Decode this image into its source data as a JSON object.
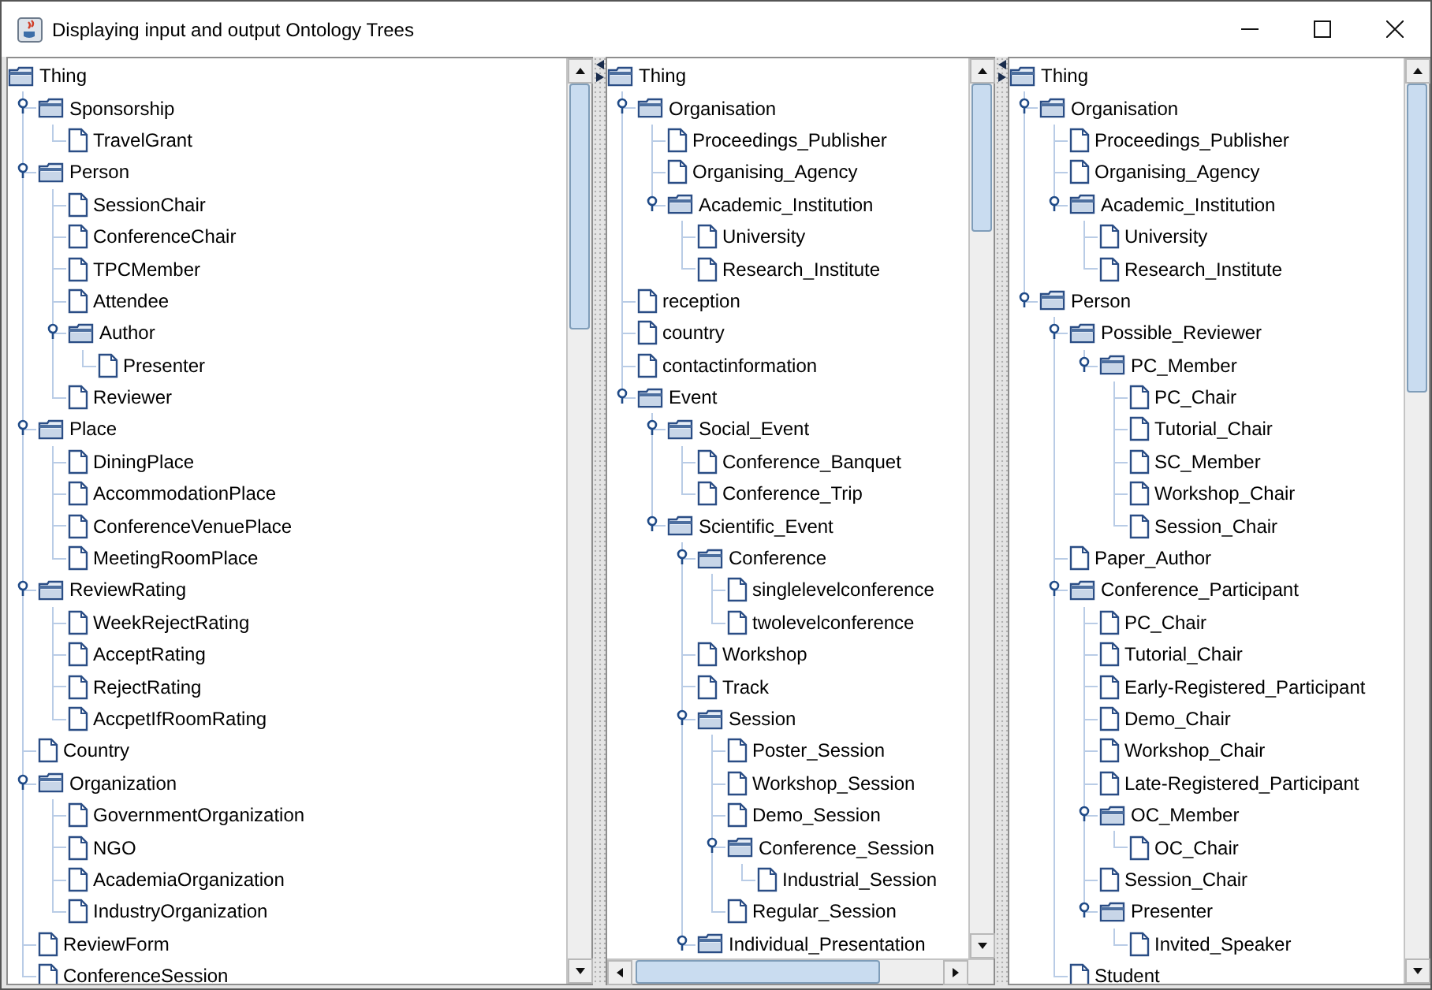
{
  "window": {
    "title": "Displaying input and output Ontology Trees"
  },
  "panes": [
    {
      "horizontal_scrollbar": false,
      "tree": {
        "label": "Thing",
        "kind": "folder",
        "expanded": true,
        "children": [
          {
            "label": "Sponsorship",
            "kind": "folder",
            "expanded": true,
            "children": [
              {
                "label": "TravelGrant",
                "kind": "leaf"
              }
            ]
          },
          {
            "label": "Person",
            "kind": "folder",
            "expanded": true,
            "children": [
              {
                "label": "SessionChair",
                "kind": "leaf"
              },
              {
                "label": "ConferenceChair",
                "kind": "leaf"
              },
              {
                "label": "TPCMember",
                "kind": "leaf"
              },
              {
                "label": "Attendee",
                "kind": "leaf"
              },
              {
                "label": "Author",
                "kind": "folder",
                "expanded": true,
                "children": [
                  {
                    "label": "Presenter",
                    "kind": "leaf"
                  }
                ]
              },
              {
                "label": "Reviewer",
                "kind": "leaf"
              }
            ]
          },
          {
            "label": "Place",
            "kind": "folder",
            "expanded": true,
            "children": [
              {
                "label": "DiningPlace",
                "kind": "leaf"
              },
              {
                "label": "AccommodationPlace",
                "kind": "leaf"
              },
              {
                "label": "ConferenceVenuePlace",
                "kind": "leaf"
              },
              {
                "label": "MeetingRoomPlace",
                "kind": "leaf"
              }
            ]
          },
          {
            "label": "ReviewRating",
            "kind": "folder",
            "expanded": true,
            "children": [
              {
                "label": "WeekRejectRating",
                "kind": "leaf"
              },
              {
                "label": "AcceptRating",
                "kind": "leaf"
              },
              {
                "label": "RejectRating",
                "kind": "leaf"
              },
              {
                "label": "AccpetIfRoomRating",
                "kind": "leaf"
              }
            ]
          },
          {
            "label": "Country",
            "kind": "leaf"
          },
          {
            "label": "Organization",
            "kind": "folder",
            "expanded": true,
            "children": [
              {
                "label": "GovernmentOrganization",
                "kind": "leaf"
              },
              {
                "label": "NGO",
                "kind": "leaf"
              },
              {
                "label": "AcademiaOrganization",
                "kind": "leaf"
              },
              {
                "label": "IndustryOrganization",
                "kind": "leaf"
              }
            ]
          },
          {
            "label": "ReviewForm",
            "kind": "leaf"
          },
          {
            "label": "ConferenceSession",
            "kind": "leaf"
          }
        ]
      }
    },
    {
      "horizontal_scrollbar": true,
      "tree": {
        "label": "Thing",
        "kind": "folder",
        "expanded": true,
        "children": [
          {
            "label": "Organisation",
            "kind": "folder",
            "expanded": true,
            "children": [
              {
                "label": "Proceedings_Publisher",
                "kind": "leaf"
              },
              {
                "label": "Organising_Agency",
                "kind": "leaf"
              },
              {
                "label": "Academic_Institution",
                "kind": "folder",
                "expanded": true,
                "children": [
                  {
                    "label": "University",
                    "kind": "leaf"
                  },
                  {
                    "label": "Research_Institute",
                    "kind": "leaf"
                  }
                ]
              }
            ]
          },
          {
            "label": "reception",
            "kind": "leaf"
          },
          {
            "label": "country",
            "kind": "leaf"
          },
          {
            "label": "contactinformation",
            "kind": "leaf"
          },
          {
            "label": "Event",
            "kind": "folder",
            "expanded": true,
            "children": [
              {
                "label": "Social_Event",
                "kind": "folder",
                "expanded": true,
                "children": [
                  {
                    "label": "Conference_Banquet",
                    "kind": "leaf"
                  },
                  {
                    "label": "Conference_Trip",
                    "kind": "leaf"
                  }
                ]
              },
              {
                "label": "Scientific_Event",
                "kind": "folder",
                "expanded": true,
                "children": [
                  {
                    "label": "Conference",
                    "kind": "folder",
                    "expanded": true,
                    "children": [
                      {
                        "label": "singlelevelconference",
                        "kind": "leaf"
                      },
                      {
                        "label": "twolevelconference",
                        "kind": "leaf"
                      }
                    ]
                  },
                  {
                    "label": "Workshop",
                    "kind": "leaf"
                  },
                  {
                    "label": "Track",
                    "kind": "leaf"
                  },
                  {
                    "label": "Session",
                    "kind": "folder",
                    "expanded": true,
                    "children": [
                      {
                        "label": "Poster_Session",
                        "kind": "leaf"
                      },
                      {
                        "label": "Workshop_Session",
                        "kind": "leaf"
                      },
                      {
                        "label": "Demo_Session",
                        "kind": "leaf"
                      },
                      {
                        "label": "Conference_Session",
                        "kind": "folder",
                        "expanded": true,
                        "children": [
                          {
                            "label": "Industrial_Session",
                            "kind": "leaf"
                          }
                        ]
                      },
                      {
                        "label": "Regular_Session",
                        "kind": "leaf"
                      }
                    ]
                  },
                  {
                    "label": "Individual_Presentation",
                    "kind": "folder",
                    "expanded": true
                  }
                ]
              }
            ]
          }
        ]
      }
    },
    {
      "horizontal_scrollbar": false,
      "tree": {
        "label": "Thing",
        "kind": "folder",
        "expanded": true,
        "children": [
          {
            "label": "Organisation",
            "kind": "folder",
            "expanded": true,
            "children": [
              {
                "label": "Proceedings_Publisher",
                "kind": "leaf"
              },
              {
                "label": "Organising_Agency",
                "kind": "leaf"
              },
              {
                "label": "Academic_Institution",
                "kind": "folder",
                "expanded": true,
                "children": [
                  {
                    "label": "University",
                    "kind": "leaf"
                  },
                  {
                    "label": "Research_Institute",
                    "kind": "leaf"
                  }
                ]
              }
            ]
          },
          {
            "label": "Person",
            "kind": "folder",
            "expanded": true,
            "children": [
              {
                "label": "Possible_Reviewer",
                "kind": "folder",
                "expanded": true,
                "children": [
                  {
                    "label": "PC_Member",
                    "kind": "folder",
                    "expanded": true,
                    "children": [
                      {
                        "label": "PC_Chair",
                        "kind": "leaf"
                      },
                      {
                        "label": "Tutorial_Chair",
                        "kind": "leaf"
                      },
                      {
                        "label": "SC_Member",
                        "kind": "leaf"
                      },
                      {
                        "label": "Workshop_Chair",
                        "kind": "leaf"
                      },
                      {
                        "label": "Session_Chair",
                        "kind": "leaf"
                      }
                    ]
                  }
                ]
              },
              {
                "label": "Paper_Author",
                "kind": "leaf"
              },
              {
                "label": "Conference_Participant",
                "kind": "folder",
                "expanded": true,
                "children": [
                  {
                    "label": "PC_Chair",
                    "kind": "leaf"
                  },
                  {
                    "label": "Tutorial_Chair",
                    "kind": "leaf"
                  },
                  {
                    "label": "Early-Registered_Participant",
                    "kind": "leaf"
                  },
                  {
                    "label": "Demo_Chair",
                    "kind": "leaf"
                  },
                  {
                    "label": "Workshop_Chair",
                    "kind": "leaf"
                  },
                  {
                    "label": "Late-Registered_Participant",
                    "kind": "leaf"
                  },
                  {
                    "label": "OC_Member",
                    "kind": "folder",
                    "expanded": true,
                    "children": [
                      {
                        "label": "OC_Chair",
                        "kind": "leaf"
                      }
                    ]
                  },
                  {
                    "label": "Session_Chair",
                    "kind": "leaf"
                  },
                  {
                    "label": "Presenter",
                    "kind": "folder",
                    "expanded": true,
                    "children": [
                      {
                        "label": "Invited_Speaker",
                        "kind": "leaf"
                      }
                    ]
                  }
                ]
              },
              {
                "label": "Student",
                "kind": "leaf"
              }
            ]
          }
        ]
      }
    }
  ]
}
